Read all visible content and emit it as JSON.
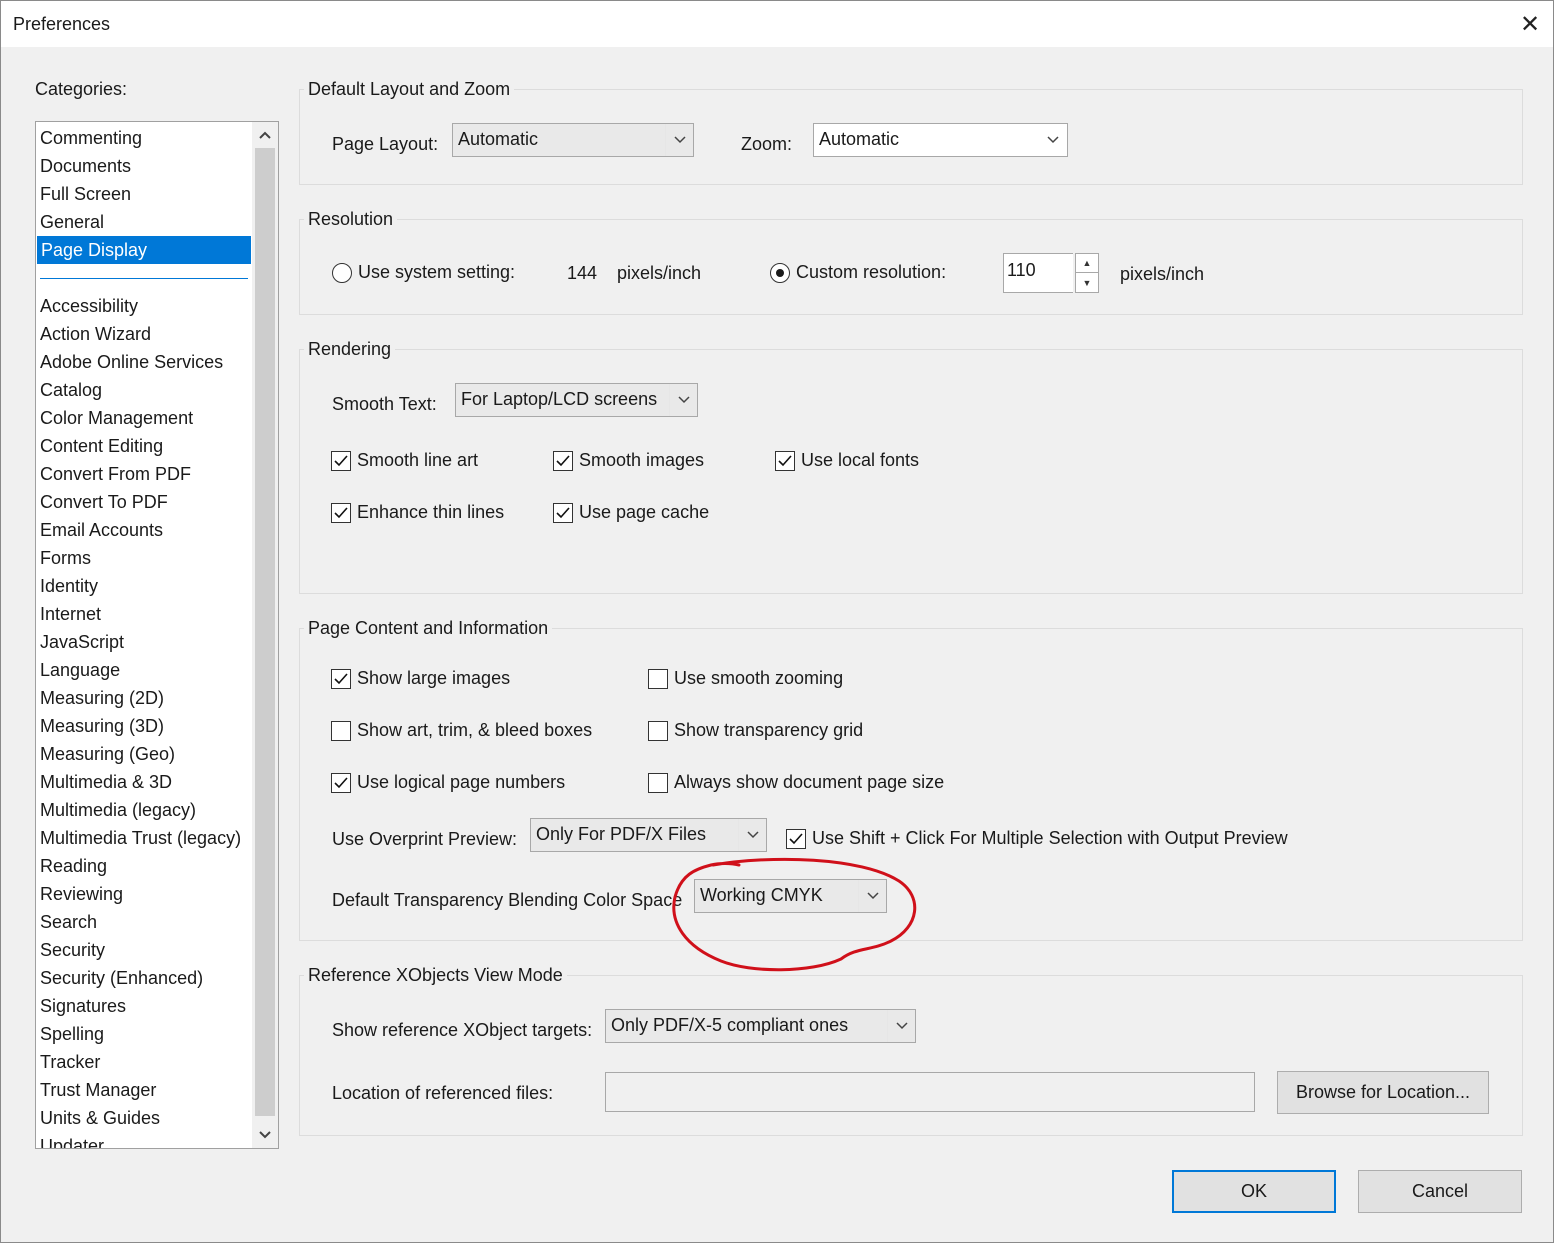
{
  "window": {
    "title": "Preferences",
    "close_icon": "close-icon"
  },
  "categories": {
    "label": "Categories:",
    "top_items": [
      "Commenting",
      "Documents",
      "Full Screen",
      "General",
      "Page Display"
    ],
    "selected": "Page Display",
    "items": [
      "Accessibility",
      "Action Wizard",
      "Adobe Online Services",
      "Catalog",
      "Color Management",
      "Content Editing",
      "Convert From PDF",
      "Convert To PDF",
      "Email Accounts",
      "Forms",
      "Identity",
      "Internet",
      "JavaScript",
      "Language",
      "Measuring (2D)",
      "Measuring (3D)",
      "Measuring (Geo)",
      "Multimedia & 3D",
      "Multimedia (legacy)",
      "Multimedia Trust (legacy)",
      "Reading",
      "Reviewing",
      "Search",
      "Security",
      "Security (Enhanced)",
      "Signatures",
      "Spelling",
      "Tracker",
      "Trust Manager",
      "Units & Guides",
      "Updater"
    ]
  },
  "layout_zoom": {
    "title": "Default Layout and Zoom",
    "page_layout_label": "Page Layout:",
    "page_layout_value": "Automatic",
    "zoom_label": "Zoom:",
    "zoom_value": "Automatic"
  },
  "resolution": {
    "title": "Resolution",
    "system_label": "Use system setting:",
    "system_value": "144",
    "system_unit": "pixels/inch",
    "custom_label": "Custom resolution:",
    "custom_value": "110",
    "custom_unit": "pixels/inch",
    "selected": "custom"
  },
  "rendering": {
    "title": "Rendering",
    "smooth_text_label": "Smooth Text:",
    "smooth_text_value": "For Laptop/LCD screens",
    "smooth_line_art": "Smooth line art",
    "smooth_images": "Smooth images",
    "use_local_fonts": "Use local fonts",
    "enhance_thin_lines": "Enhance thin lines",
    "use_page_cache": "Use page cache"
  },
  "page_content": {
    "title": "Page Content and Information",
    "show_large_images": "Show large images",
    "use_smooth_zooming": "Use smooth zooming",
    "show_boxes": "Show art, trim, & bleed boxes",
    "show_transparency_grid": "Show transparency grid",
    "use_logical_page_numbers": "Use logical page numbers",
    "always_show_page_size": "Always show document page size",
    "overprint_label": "Use Overprint Preview:",
    "overprint_value": "Only For PDF/X Files",
    "shift_click_label": "Use Shift + Click For Multiple Selection with Output Preview",
    "blending_label": "Default Transparency Blending Color Space",
    "blending_value": "Working CMYK"
  },
  "xobjects": {
    "title": "Reference XObjects View Mode",
    "targets_label": "Show reference XObject targets:",
    "targets_value": "Only PDF/X-5 compliant ones",
    "location_label": "Location of referenced files:",
    "location_value": "",
    "browse_label": "Browse for Location..."
  },
  "buttons": {
    "ok": "OK",
    "cancel": "Cancel"
  },
  "colors": {
    "accent": "#0078d7",
    "annotation": "#d0101a"
  }
}
